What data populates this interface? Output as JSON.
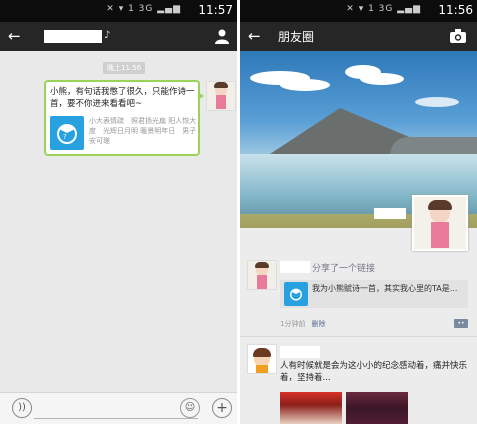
{
  "status_bar_left": {
    "icons": "✕ ▾ 1 3G ▂▄▆",
    "time": "11:57"
  },
  "status_bar_right": {
    "icons": "✕ ▾ 1 3G ▂▄▆",
    "time": "11:56"
  },
  "chat": {
    "timestamp": "晚上11:56",
    "message": "小熊，有句话我憋了很久，只能作诗一首，要不你进来看看吧~",
    "link_desc": "小大表情疏　照君扬光扁 阳人恢大度　光辉日月明 暖景明年日　男子安可瑳",
    "voice_icon": "voice-icon",
    "emoji_icon": "emoji-icon",
    "plus_icon": "plus-icon"
  },
  "moments": {
    "title": "朋友圈",
    "post1": {
      "action": "分享了一个链接",
      "link_title": "我为小熊赋诗一首，其实我心里的TA是...",
      "time": "1分钟前",
      "delete": "删除"
    },
    "post2": {
      "text": "人有时候就是会为这小小的纪念感动着，痛并快乐着，坚持着..."
    }
  },
  "colors": {
    "accent_green": "#9bd35a",
    "link_blue": "#28a1e0",
    "header_dark": "#262626"
  }
}
